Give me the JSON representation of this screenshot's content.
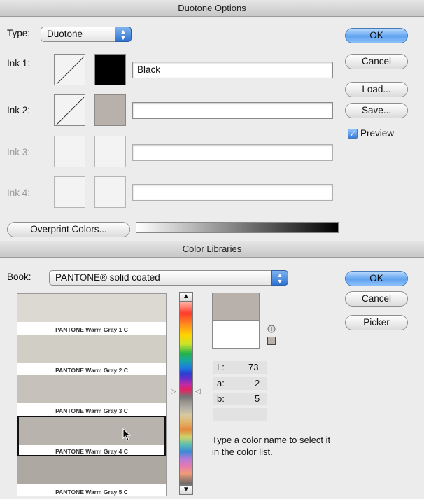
{
  "duotone": {
    "title": "Duotone Options",
    "type_label": "Type:",
    "type_value": "Duotone",
    "inks": [
      {
        "label": "Ink 1:",
        "name": "Black",
        "color": "#000000",
        "enabled": true
      },
      {
        "label": "Ink 2:",
        "name": "",
        "color": "#b8b1ab",
        "enabled": true
      },
      {
        "label": "Ink 3:",
        "name": "",
        "color": "",
        "enabled": false
      },
      {
        "label": "Ink 4:",
        "name": "",
        "color": "",
        "enabled": false
      }
    ],
    "buttons": {
      "ok": "OK",
      "cancel": "Cancel",
      "load": "Load...",
      "save": "Save..."
    },
    "preview_label": "Preview",
    "preview_checked": true,
    "overprint_label": "Overprint Colors..."
  },
  "color_libraries": {
    "title": "Color Libraries",
    "book_label": "Book:",
    "book_value": "PANTONE® solid coated",
    "buttons": {
      "ok": "OK",
      "cancel": "Cancel",
      "picker": "Picker"
    },
    "swatches": [
      {
        "name": "PANTONE Warm Gray 1 C",
        "color": "#dcd9d2",
        "selected": false
      },
      {
        "name": "PANTONE Warm Gray 2 C",
        "color": "#d1cec6",
        "selected": false
      },
      {
        "name": "PANTONE Warm Gray 3 C",
        "color": "#c6c1ba",
        "selected": false
      },
      {
        "name": "PANTONE Warm Gray 4 C",
        "color": "#b9b3ad",
        "selected": true
      },
      {
        "name": "PANTONE Warm Gray 5 C",
        "color": "#aea8a2",
        "selected": false
      }
    ],
    "lab": {
      "L_label": "L:",
      "L": "73",
      "a_label": "a:",
      "a": "2",
      "b_label": "b:",
      "b": "5"
    },
    "new_color": "#b8b1ab",
    "original_color": "#ffffff",
    "hint": "Type a color name to select it in the color list."
  }
}
